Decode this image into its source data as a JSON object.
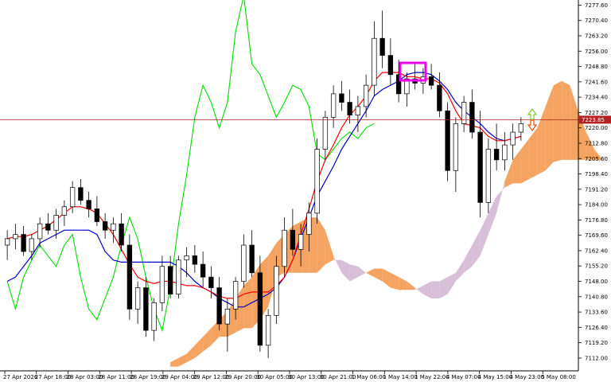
{
  "chart_data": {
    "type": "candlestick",
    "indicator": "Ichimoku Kinko Hyo",
    "ylim": [
      7106.0,
      7280.0
    ],
    "y_ticks": [
      "7277.60",
      "7270.40",
      "7263.20",
      "7256.00",
      "7248.80",
      "7241.60",
      "7234.40",
      "7227.20",
      "7220.00",
      "7212.80",
      "7205.60",
      "7198.40",
      "7191.20",
      "7184.00",
      "7176.80",
      "7169.60",
      "7162.40",
      "7155.20",
      "7148.00",
      "7140.80",
      "7133.60",
      "7126.40",
      "7119.20",
      "7112.00"
    ],
    "x_ticks": [
      "27 Apr 2026",
      "27 Apr 18:00",
      "28 Apr 03:00",
      "28 Apr 11:00",
      "28 Apr 19:00",
      "29 Apr 04:00",
      "29 Apr 12:00",
      "29 Apr 20:00",
      "30 Apr 05:00",
      "30 Apr 13:00",
      "30 Apr 21:00",
      "1 May 06:00",
      "1 May 14:00",
      "1 May 22:00",
      "4 May 07:00",
      "4 May 15:00",
      "4 May 23:00",
      "5 May 08:00"
    ],
    "current_price": "7223.85",
    "colors": {
      "tenkan": "#ff0000",
      "kijun": "#0000cc",
      "chikou": "#00dd00",
      "cloud_bull": "#f4a460",
      "cloud_bear": "#d8bfd8",
      "candle": "#000000",
      "price_line": "#b22222",
      "highlight_box": "#ee00ee",
      "arrow_up": "#7ccd2b",
      "arrow_down": "#ff4500",
      "pink_line": "#ff69b4",
      "teal_line": "#2e6b6b"
    },
    "candles": [
      [
        7165,
        7172,
        7158,
        7168
      ],
      [
        7168,
        7175,
        7163,
        7170
      ],
      [
        7170,
        7174,
        7160,
        7162
      ],
      [
        7162,
        7170,
        7158,
        7168
      ],
      [
        7168,
        7178,
        7164,
        7175
      ],
      [
        7175,
        7180,
        7170,
        7172
      ],
      [
        7172,
        7182,
        7168,
        7179
      ],
      [
        7179,
        7186,
        7174,
        7183
      ],
      [
        7183,
        7195,
        7180,
        7192
      ],
      [
        7192,
        7196,
        7184,
        7186
      ],
      [
        7186,
        7190,
        7178,
        7182
      ],
      [
        7182,
        7188,
        7174,
        7176
      ],
      [
        7176,
        7180,
        7168,
        7172
      ],
      [
        7172,
        7178,
        7166,
        7175
      ],
      [
        7175,
        7180,
        7162,
        7165
      ],
      [
        7165,
        7170,
        7130,
        7135
      ],
      [
        7135,
        7148,
        7128,
        7145
      ],
      [
        7145,
        7150,
        7122,
        7125
      ],
      [
        7125,
        7140,
        7120,
        7138
      ],
      [
        7138,
        7160,
        7134,
        7155
      ],
      [
        7155,
        7160,
        7140,
        7142
      ],
      [
        7142,
        7160,
        7140,
        7158
      ],
      [
        7158,
        7164,
        7150,
        7160
      ],
      [
        7160,
        7165,
        7152,
        7156
      ],
      [
        7156,
        7162,
        7145,
        7150
      ],
      [
        7150,
        7155,
        7140,
        7145
      ],
      [
        7145,
        7150,
        7125,
        7128
      ],
      [
        7128,
        7140,
        7115,
        7135
      ],
      [
        7135,
        7150,
        7130,
        7148
      ],
      [
        7148,
        7170,
        7145,
        7165
      ],
      [
        7165,
        7172,
        7150,
        7152
      ],
      [
        7152,
        7160,
        7115,
        7118
      ],
      [
        7118,
        7135,
        7112,
        7132
      ],
      [
        7132,
        7160,
        7128,
        7155
      ],
      [
        7155,
        7178,
        7150,
        7172
      ],
      [
        7172,
        7182,
        7160,
        7163
      ],
      [
        7163,
        7175,
        7155,
        7170
      ],
      [
        7170,
        7185,
        7162,
        7180
      ],
      [
        7180,
        7215,
        7175,
        7210
      ],
      [
        7210,
        7228,
        7205,
        7225
      ],
      [
        7225,
        7240,
        7220,
        7236
      ],
      [
        7236,
        7242,
        7228,
        7232
      ],
      [
        7232,
        7238,
        7222,
        7226
      ],
      [
        7226,
        7235,
        7218,
        7230
      ],
      [
        7230,
        7245,
        7225,
        7240
      ],
      [
        7240,
        7270,
        7235,
        7262
      ],
      [
        7262,
        7275,
        7248,
        7254
      ],
      [
        7254,
        7262,
        7240,
        7245
      ],
      [
        7245,
        7252,
        7232,
        7236
      ],
      [
        7236,
        7246,
        7230,
        7243
      ],
      [
        7243,
        7250,
        7238,
        7241
      ],
      [
        7241,
        7248,
        7236,
        7244
      ],
      [
        7244,
        7250,
        7238,
        7240
      ],
      [
        7240,
        7246,
        7225,
        7228
      ],
      [
        7228,
        7232,
        7195,
        7200
      ],
      [
        7200,
        7225,
        7190,
        7222
      ],
      [
        7222,
        7235,
        7218,
        7232
      ],
      [
        7232,
        7238,
        7215,
        7218
      ],
      [
        7218,
        7228,
        7178,
        7185
      ],
      [
        7185,
        7215,
        7180,
        7210
      ],
      [
        7210,
        7222,
        7200,
        7205
      ],
      [
        7205,
        7218,
        7200,
        7212
      ],
      [
        7212,
        7222,
        7205,
        7218
      ],
      [
        7218,
        7225,
        7214,
        7222
      ]
    ],
    "tenkan": [
      7168,
      7169,
      7169,
      7170,
      7172,
      7174,
      7177,
      7180,
      7183,
      7183,
      7182,
      7180,
      7175,
      7170,
      7163,
      7156,
      7150,
      7148,
      7147,
      7148,
      7148,
      7147,
      7146,
      7146,
      7145,
      7143,
      7141,
      7140,
      7140,
      7142,
      7143,
      7143,
      7143,
      7146,
      7150,
      7158,
      7170,
      7182,
      7195,
      7205,
      7212,
      7220,
      7226,
      7230,
      7235,
      7242,
      7246,
      7246,
      7246,
      7244,
      7244,
      7243,
      7243,
      7241,
      7236,
      7228,
      7222,
      7221,
      7220,
      7216,
      7214,
      7214,
      7215,
      7216
    ],
    "kijun": [
      7148,
      7150,
      7155,
      7160,
      7166,
      7168,
      7170,
      7172,
      7172,
      7172,
      7172,
      7170,
      7162,
      7158,
      7157,
      7157,
      7157,
      7157,
      7157,
      7157,
      7157,
      7155,
      7152,
      7148,
      7145,
      7143,
      7140,
      7138,
      7136,
      7136,
      7138,
      7140,
      7142,
      7145,
      7150,
      7158,
      7168,
      7178,
      7188,
      7195,
      7202,
      7210,
      7216,
      7222,
      7228,
      7235,
      7238,
      7240,
      7242,
      7245,
      7246,
      7246,
      7245,
      7242,
      7238,
      7232,
      7228,
      7225,
      7222,
      7218,
      7215,
      7214,
      7215,
      7216
    ],
    "chikou": [
      7148,
      7135,
      7150,
      7158,
      7165,
      7160,
      7155,
      7165,
      7170,
      7150,
      7135,
      7130,
      7140,
      7150,
      7165,
      7178,
      7168,
      7150,
      7135,
      7125,
      7145,
      7175,
      7198,
      7225,
      7240,
      7232,
      7220,
      7232,
      7265,
      7282,
      7250,
      7245,
      7235,
      7225,
      7232,
      7240,
      7238,
      7230,
      7208,
      7205,
      7210,
      7215,
      7218,
      7215,
      7220,
      7222
    ],
    "senkou_a": [
      7110,
      7112,
      7114,
      7118,
      7122,
      7126,
      7130,
      7134,
      7140,
      7146,
      7150,
      7156,
      7160,
      7166,
      7170,
      7174,
      7176,
      7178,
      7178,
      7172,
      7160,
      7152,
      7148,
      7150,
      7152,
      7154,
      7154,
      7152,
      7150,
      7148,
      7145,
      7142,
      7140,
      7140,
      7142,
      7148,
      7152,
      7155,
      7160,
      7170,
      7180,
      7195,
      7205,
      7210,
      7215,
      7220,
      7230,
      7240,
      7242,
      7240,
      7228,
      7218,
      7210,
      7205
    ],
    "senkou_b": [
      7108,
      7108,
      7110,
      7112,
      7115,
      7118,
      7122,
      7122,
      7124,
      7126,
      7126,
      7130,
      7136,
      7150,
      7152,
      7152,
      7152,
      7152,
      7152,
      7156,
      7158,
      7158,
      7156,
      7155,
      7152,
      7150,
      7148,
      7145,
      7144,
      7144,
      7144,
      7146,
      7148,
      7148,
      7150,
      7152,
      7158,
      7165,
      7172,
      7180,
      7188,
      7192,
      7194,
      7194,
      7196,
      7198,
      7200,
      7204,
      7205,
      7205,
      7205,
      7205,
      7205,
      7205
    ]
  }
}
